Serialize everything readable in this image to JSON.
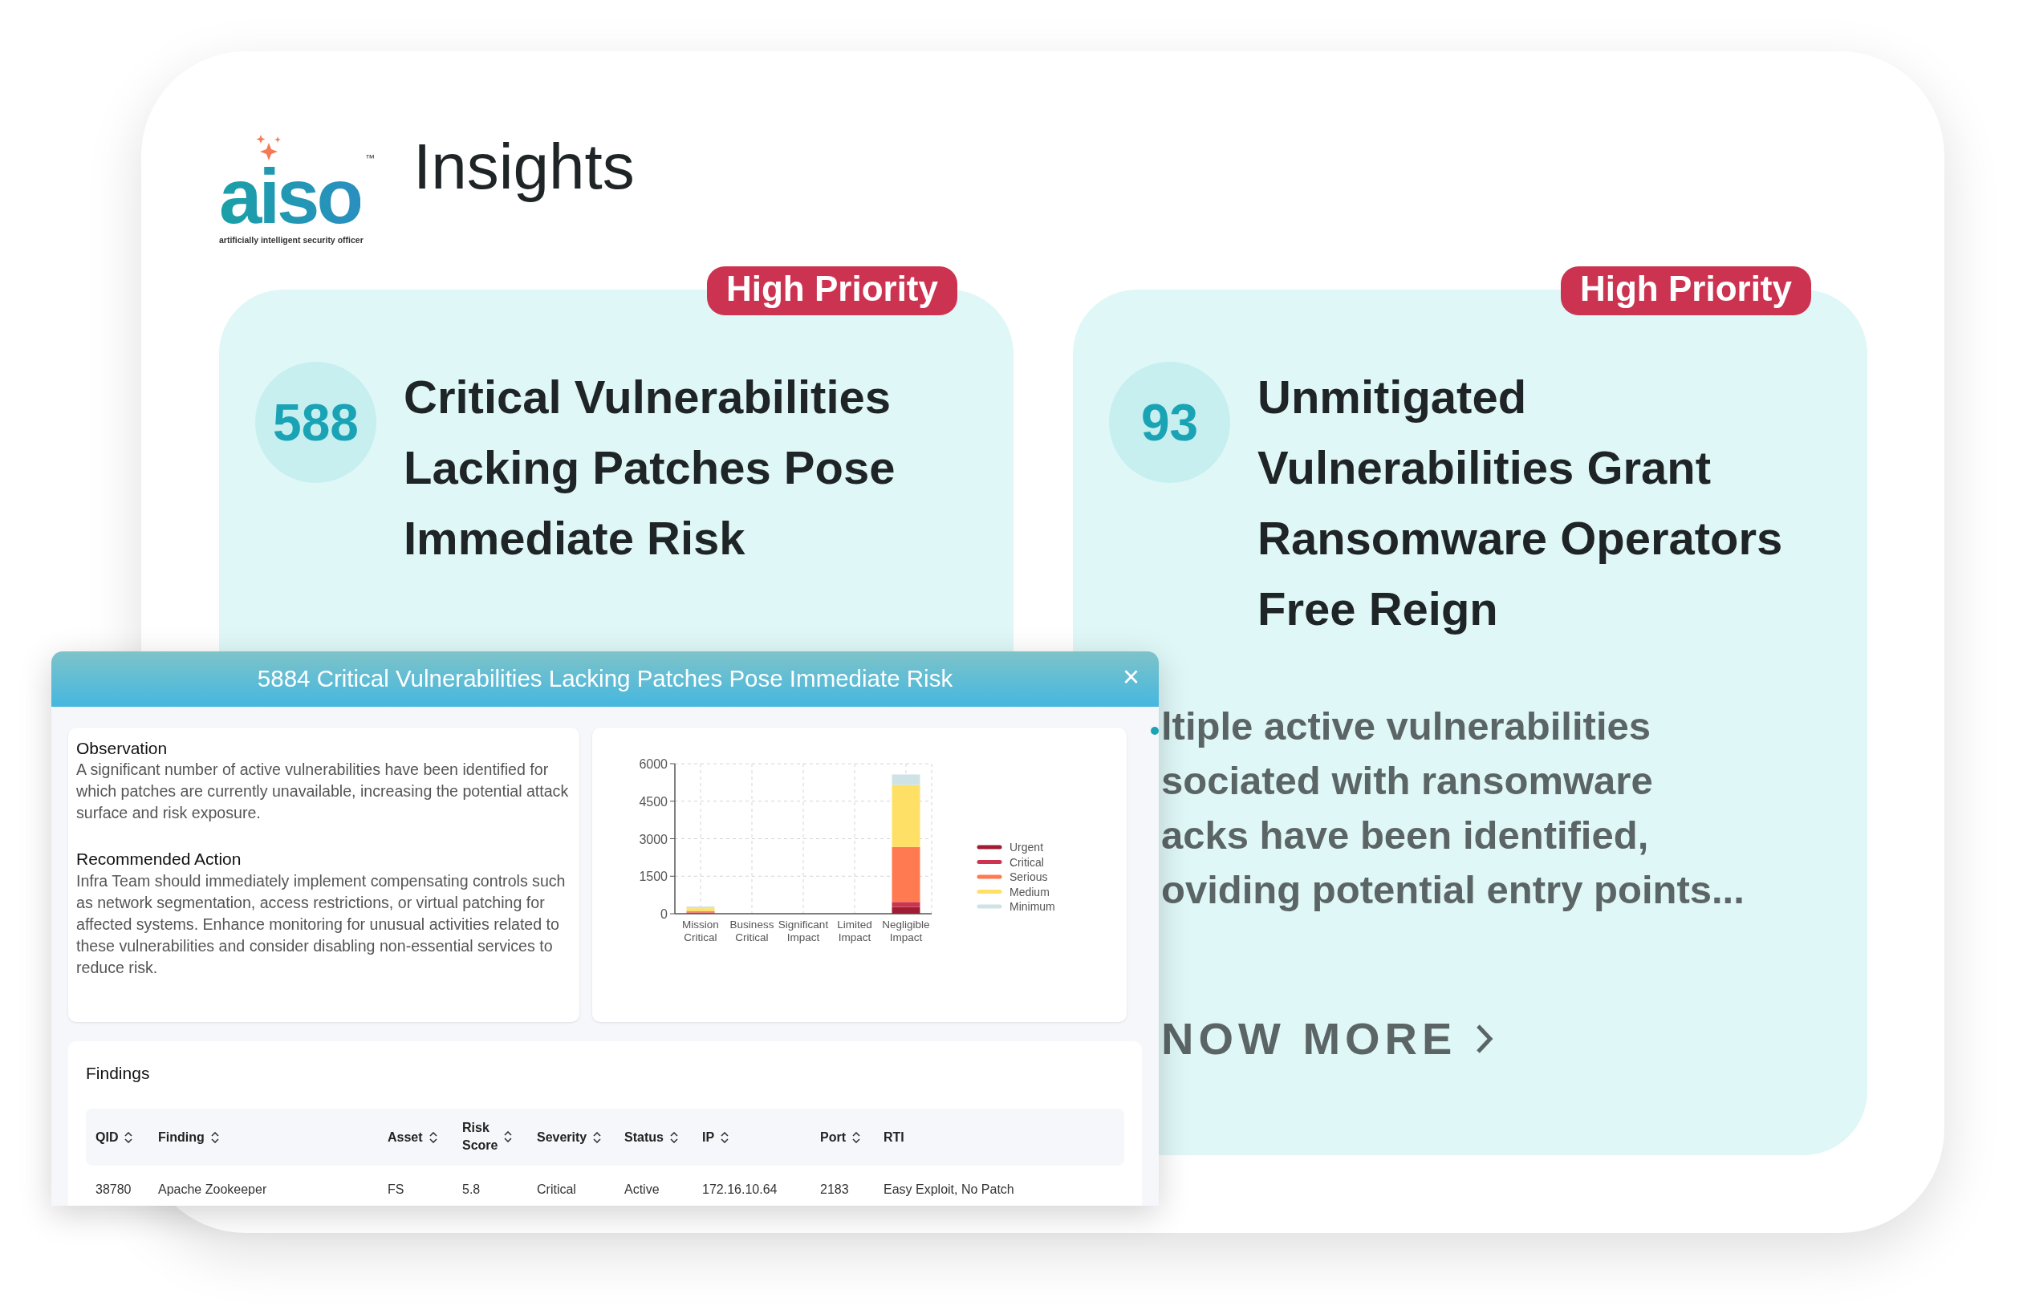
{
  "logo": {
    "wordmark": "aiso",
    "trademark": "™",
    "tagline": "artificially intelligent security officer"
  },
  "page_title": "Insights",
  "insight_cards": [
    {
      "badge": "High Priority",
      "count": "588",
      "title_lines": [
        "Critical Vulnerabilities",
        "Lacking Patches Pose",
        "Immediate Risk"
      ]
    },
    {
      "badge": "High Priority",
      "count": "93",
      "title_lines": [
        "Unmitigated",
        "Vulnerabilities Grant",
        "Ransomware Operators",
        "Free Reign"
      ],
      "description_lines": [
        "ltiple active vulnerabilities",
        "sociated with ransomware",
        "acks have been identified,",
        "oviding potential entry points..."
      ],
      "link": "NOW MORE"
    }
  ],
  "modal": {
    "title": "5884 Critical Vulnerabilities Lacking Patches Pose Immediate Risk",
    "close": "×",
    "sections": [
      {
        "heading": "Observation",
        "text": "A significant number of active vulnerabilities have been identified for which patches are currently unavailable, increasing the potential attack surface and risk exposure."
      },
      {
        "heading": "Recommended Action",
        "text": "Infra Team should immediately implement compensating controls such as network segmentation, access restrictions, or virtual patching for affected systems. Enhance monitoring for unusual activities related to these vulnerabilities and consider disabling non-essential services to reduce risk."
      }
    ],
    "chart_data": {
      "type": "bar",
      "stacked": true,
      "grid": true,
      "legend": true,
      "categories": [
        "Mission Critical",
        "Business Critical",
        "Significant Impact",
        "Limited Impact",
        "Negligible Impact"
      ],
      "ylim": [
        0,
        6000
      ],
      "yticks": [
        0,
        1500,
        3000,
        4500,
        6000
      ],
      "series": [
        {
          "name": "Urgent",
          "color": "#a01c33",
          "values": [
            0,
            0,
            0,
            0,
            270
          ]
        },
        {
          "name": "Critical",
          "color": "#cc3350",
          "values": [
            50,
            0,
            0,
            0,
            200
          ]
        },
        {
          "name": "Serious",
          "color": "#ff7a50",
          "values": [
            50,
            0,
            0,
            0,
            2200
          ]
        },
        {
          "name": "Medium",
          "color": "#ffe066",
          "values": [
            120,
            0,
            0,
            0,
            2480
          ]
        },
        {
          "name": "Minimum",
          "color": "#cfe3e6",
          "values": [
            70,
            0,
            0,
            0,
            420
          ]
        }
      ]
    },
    "findings": {
      "title": "Findings",
      "columns": [
        {
          "label": "QID",
          "sortable": true
        },
        {
          "label": "Finding",
          "sortable": true
        },
        {
          "label": "Asset",
          "sortable": true
        },
        {
          "label": "Risk Score",
          "sortable": true
        },
        {
          "label": "Severity",
          "sortable": true
        },
        {
          "label": "Status",
          "sortable": true
        },
        {
          "label": "IP",
          "sortable": true
        },
        {
          "label": "Port",
          "sortable": true
        },
        {
          "label": "RTI",
          "sortable": false
        }
      ],
      "rows": [
        [
          "38780",
          "Apache Zookeeper",
          "FS",
          "5.8",
          "Critical",
          "Active",
          "172.16.10.64",
          "2183",
          "Easy Exploit, No Patch"
        ]
      ]
    }
  }
}
